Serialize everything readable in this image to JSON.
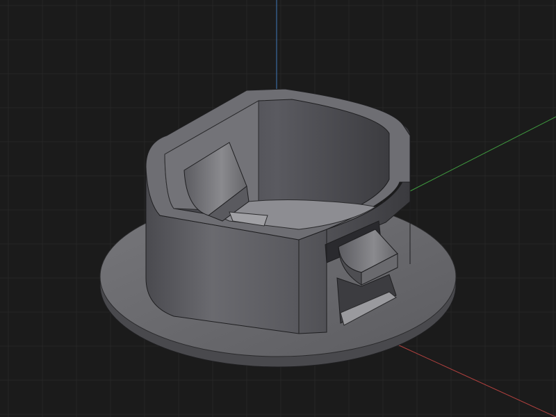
{
  "viewport": {
    "background_color": "#1b1b1b",
    "grid_minor_color": "#262626",
    "grid_major_color": "#2f2f2f"
  },
  "axes": {
    "x_color": "#b3413f",
    "y_color": "#3f9a3f",
    "z_color": "#3f78b8"
  },
  "model": {
    "body_light": "#7c7c80",
    "body_mid": "#5e5e63",
    "body_dark": "#3e3e42",
    "flange_top": "#6f6f73",
    "flange_edge": "#4a4a4e",
    "inner_wall": "#535358",
    "inner_floor": "#9a9a9e",
    "edge_line": "#1e1e20"
  }
}
